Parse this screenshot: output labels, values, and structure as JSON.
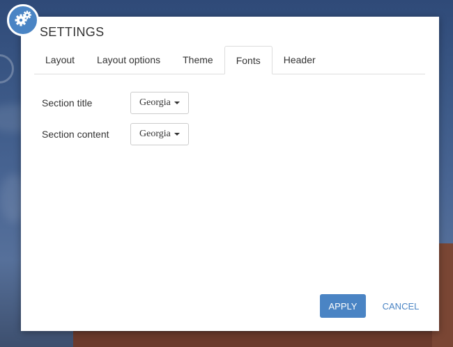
{
  "dialog": {
    "title": "SETTINGS",
    "accent_color": "#4a84c4",
    "icon": "gears-icon"
  },
  "tabs": [
    {
      "label": "Layout",
      "active": false
    },
    {
      "label": "Layout options",
      "active": false
    },
    {
      "label": "Theme",
      "active": false
    },
    {
      "label": "Fonts",
      "active": true
    },
    {
      "label": "Header",
      "active": false
    }
  ],
  "fonts": {
    "section_title": {
      "label": "Section title",
      "value": "Georgia"
    },
    "section_content": {
      "label": "Section content",
      "value": "Georgia"
    }
  },
  "actions": {
    "apply_label": "APPLY",
    "cancel_label": "CANCEL"
  }
}
